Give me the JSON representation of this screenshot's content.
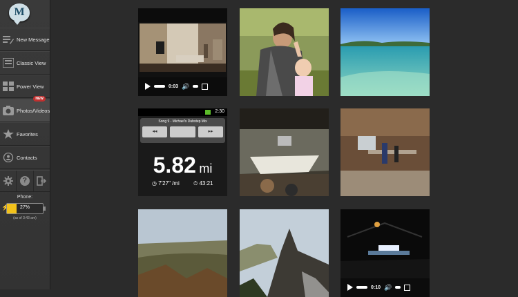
{
  "sidebar": {
    "logo_letter": "M",
    "items": [
      {
        "label": "New Message",
        "icon": "compose-icon"
      },
      {
        "label": "Classic View",
        "icon": "classic-view-icon"
      },
      {
        "label": "Power View",
        "icon": "power-view-icon"
      },
      {
        "label": "Photos/Videos",
        "icon": "camera-icon",
        "badge": "NEW",
        "active": true
      },
      {
        "label": "Favorites",
        "icon": "star-icon"
      },
      {
        "label": "Contacts",
        "icon": "contacts-icon"
      }
    ],
    "tools": [
      {
        "icon": "gear-icon"
      },
      {
        "icon": "help-icon",
        "glyph": "?"
      },
      {
        "icon": "logout-icon"
      }
    ]
  },
  "phone": {
    "title": "Phone:",
    "battery_percent_label": "27%",
    "battery_level": 0.27,
    "as_of": "(as of 3:43 am)",
    "battery_color": "#f2c21b"
  },
  "tiles": [
    {
      "kind": "video",
      "time": "0:03"
    },
    {
      "kind": "photo"
    },
    {
      "kind": "photo"
    },
    {
      "kind": "app-screenshot",
      "status_time": "2:30",
      "song": "Song 9 - Michael's Dubstep Mix",
      "distance": "5.82",
      "unit": "mi",
      "pace": "7'27\" /mi",
      "duration": "43:21"
    },
    {
      "kind": "photo"
    },
    {
      "kind": "photo"
    },
    {
      "kind": "photo"
    },
    {
      "kind": "photo"
    },
    {
      "kind": "video",
      "time": "0:10"
    }
  ]
}
